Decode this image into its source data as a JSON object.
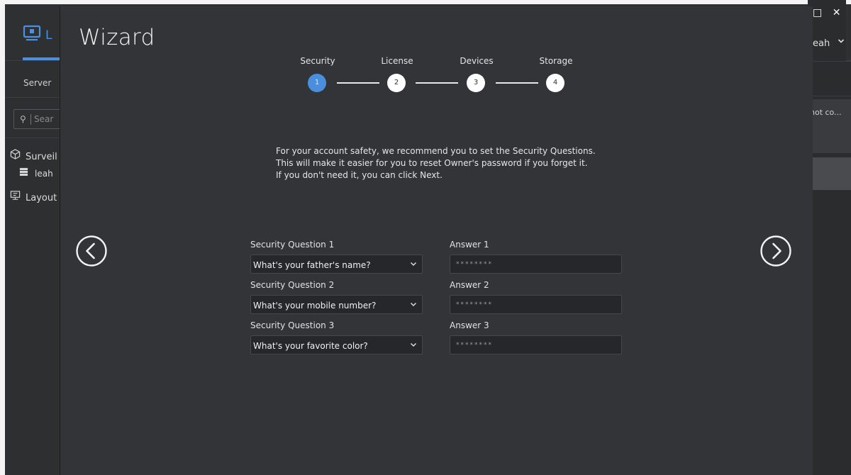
{
  "app": {
    "tab_letter": "L",
    "left_tab": "Server",
    "search_placeholder": "Sear",
    "tree": [
      {
        "label": "Surveil",
        "icon": "cube-icon"
      },
      {
        "label": "leah",
        "icon": "server-icon"
      },
      {
        "label": "Layout",
        "icon": "layout-icon"
      }
    ],
    "user": "eah",
    "right_row_text": "not co...",
    "window_buttons": [
      "□",
      "✕"
    ],
    "accent_color": "#4a90e2"
  },
  "wizard": {
    "title": "Wizard",
    "steps": [
      {
        "label": "Security",
        "number": "1",
        "active": true
      },
      {
        "label": "License",
        "number": "2",
        "active": false
      },
      {
        "label": "Devices",
        "number": "3",
        "active": false
      },
      {
        "label": "Storage",
        "number": "4",
        "active": false
      }
    ],
    "intro_lines": [
      "For your account safety, we recommend you to set the Security Questions.",
      "This will make it easier for you to reset Owner's password if you forget it.",
      "If you don't need it, you can click Next."
    ],
    "questions": [
      {
        "label": "Security Question 1",
        "value": "What's your father's name?",
        "answer_label": "Answer 1",
        "answer_value": "********"
      },
      {
        "label": "Security Question 2",
        "value": "What's your mobile number?",
        "answer_label": "Answer 2",
        "answer_value": "********"
      },
      {
        "label": "Security Question 3",
        "value": "What's your favorite color?",
        "answer_label": "Answer 3",
        "answer_value": "********"
      }
    ],
    "prev_icon": "chevron-left-circle-icon",
    "next_icon": "chevron-right-circle-icon",
    "active_step_color": "#4a8fde"
  }
}
